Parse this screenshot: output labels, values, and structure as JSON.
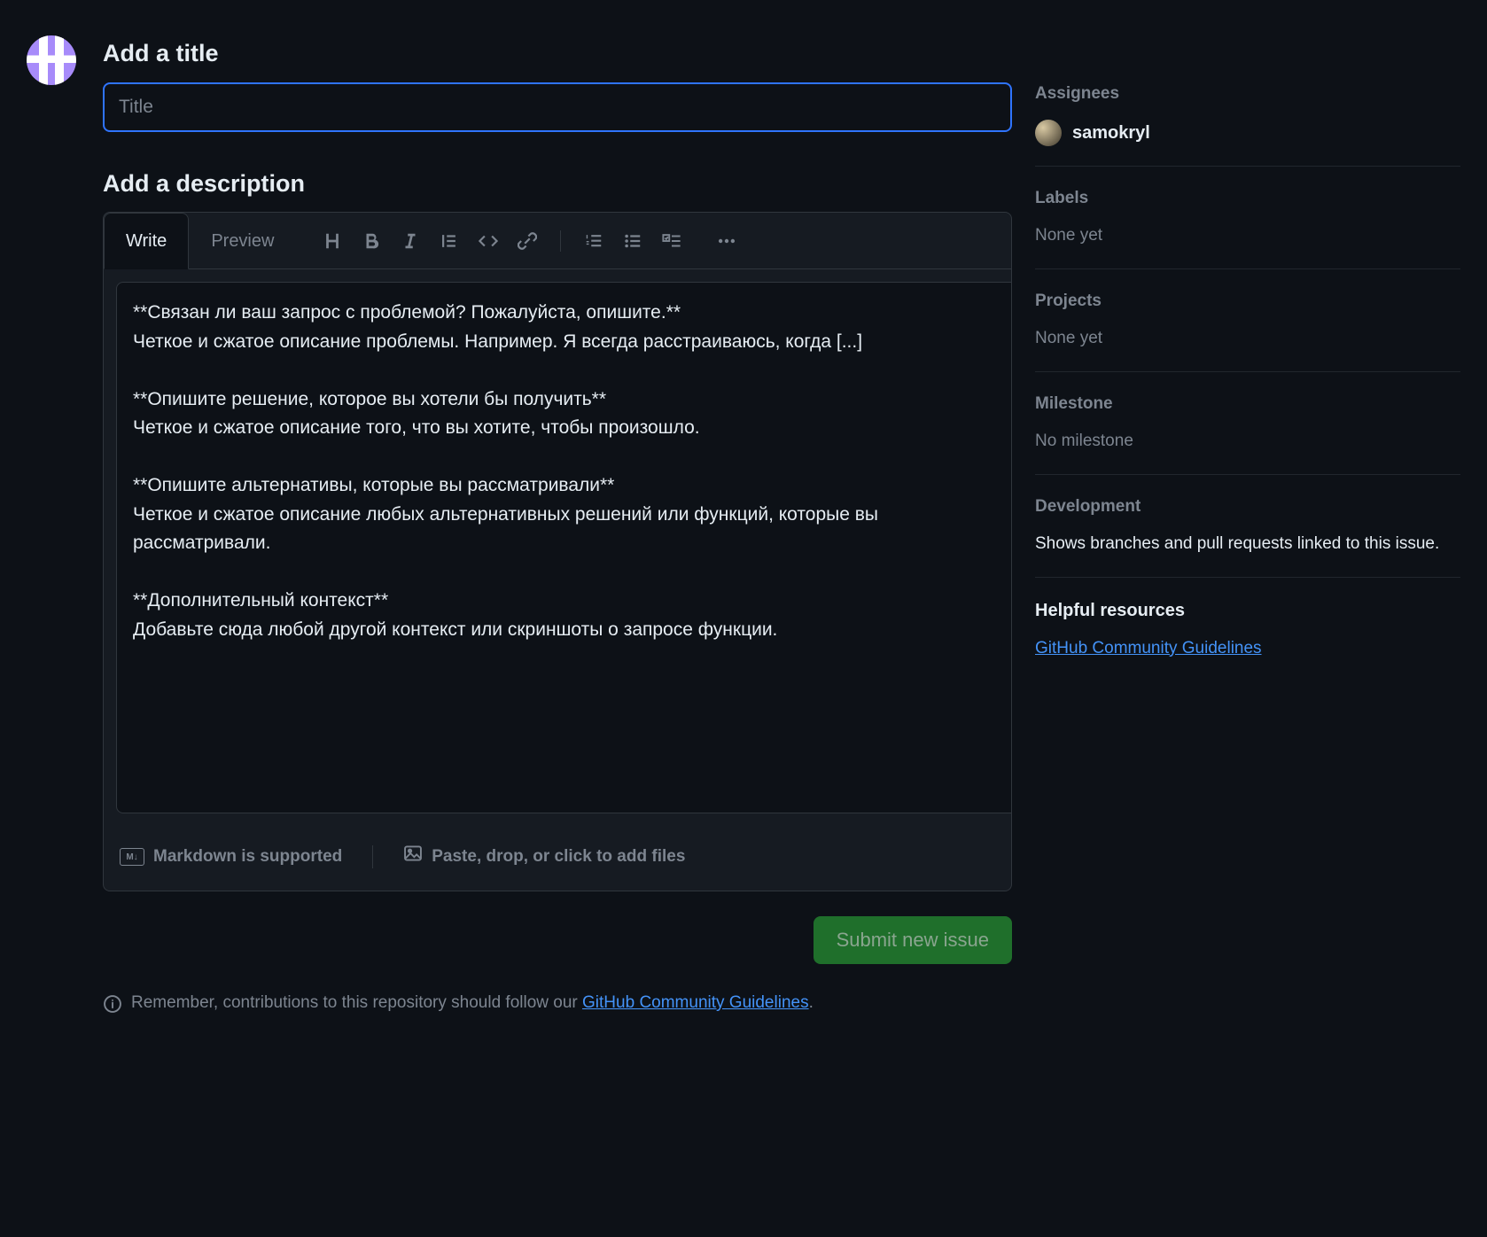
{
  "title_section": {
    "label": "Add a title",
    "placeholder": "Title",
    "value": ""
  },
  "description_section": {
    "label": "Add a description",
    "tabs": {
      "write": "Write",
      "preview": "Preview"
    },
    "body": "**Связан ли ваш запрос с проблемой? Пожалуйста, опишите.**\nЧеткое и сжатое описание проблемы. Например. Я всегда расстраиваюсь, когда [...]\n\n**Опишите решение, которое вы хотели бы получить**\nЧеткое и сжатое описание того, что вы хотите, чтобы произошло.\n\n**Опишите альтернативы, которые вы рассматривали**\nЧеткое и сжатое описание любых альтернативных решений или функций, которые вы рассматривали.\n\n**Дополнительный контекст**\nДобавьте сюда любой другой контекст или скриншоты о запросе функции.",
    "footer": {
      "markdown": "Markdown is supported",
      "attach": "Paste, drop, or click to add files"
    }
  },
  "submit_label": "Submit new issue",
  "reminder": {
    "prefix": "Remember, contributions to this repository should follow our ",
    "link_text": "GitHub Community Guidelines",
    "suffix": "."
  },
  "sidebar": {
    "assignees": {
      "title": "Assignees",
      "user": "samokryl"
    },
    "labels": {
      "title": "Labels",
      "value": "None yet"
    },
    "projects": {
      "title": "Projects",
      "value": "None yet"
    },
    "milestone": {
      "title": "Milestone",
      "value": "No milestone"
    },
    "development": {
      "title": "Development",
      "value": "Shows branches and pull requests linked to this issue."
    },
    "resources": {
      "title": "Helpful resources",
      "link": "GitHub Community Guidelines"
    }
  }
}
